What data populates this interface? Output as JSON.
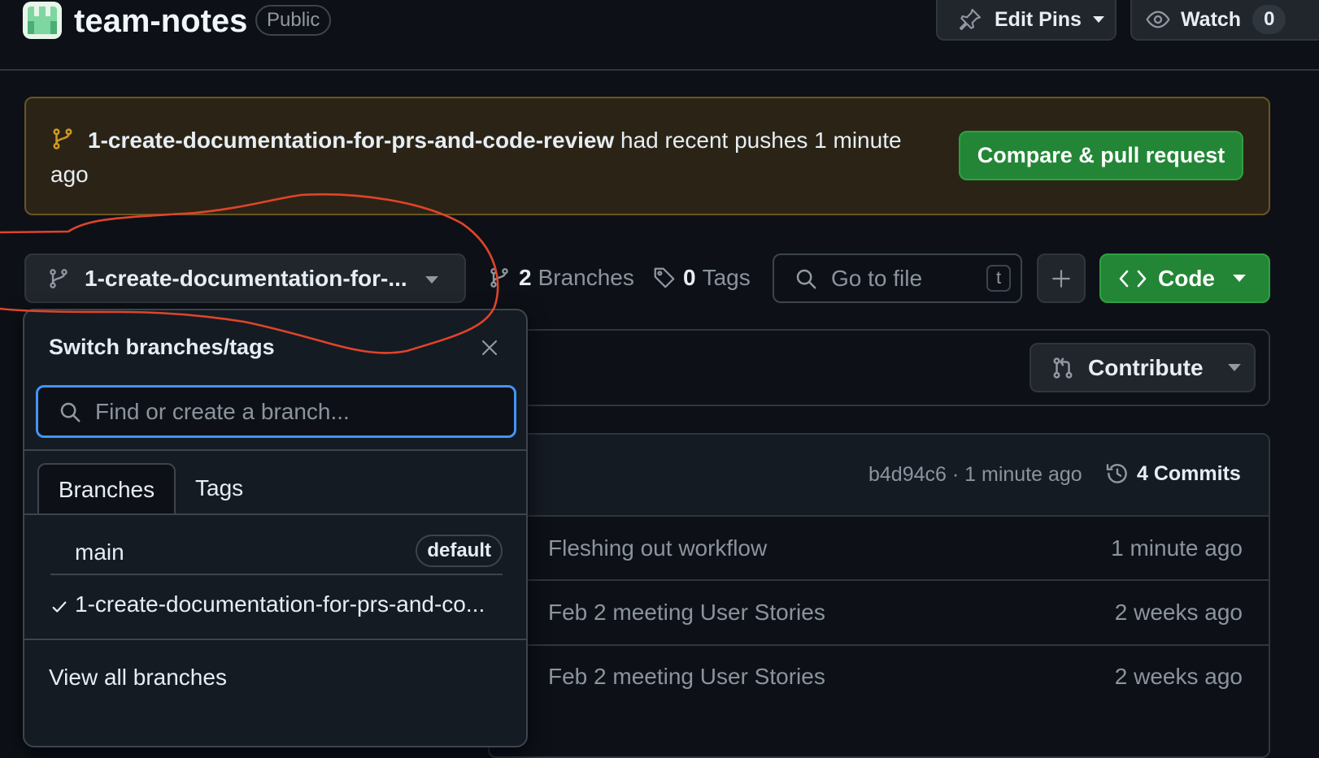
{
  "repo": {
    "name": "team-notes",
    "visibility": "Public"
  },
  "header": {
    "edit_pins_label": "Edit Pins",
    "watch_label": "Watch",
    "watch_count": "0"
  },
  "banner": {
    "branch_name": "1-create-documentation-for-prs-and-code-review",
    "message": "had recent pushes 1 minute ago",
    "compare_button": "Compare & pull request"
  },
  "toolbar": {
    "branch_selector_label": "1-create-documentation-for-...",
    "branches_count": "2",
    "branches_label": "Branches",
    "tags_count": "0",
    "tags_label": "Tags",
    "goto_placeholder": "Go to file",
    "goto_shortcut": "t",
    "code_label": "Code"
  },
  "contribute": {
    "label": "Contribute"
  },
  "commit_info": {
    "sha_time": "b4d94c6 · 1 minute ago",
    "commits_label": "4 Commits"
  },
  "files": [
    {
      "message": "Fleshing out workflow",
      "time": "1 minute ago"
    },
    {
      "message": "Feb 2 meeting User Stories",
      "time": "2 weeks ago"
    },
    {
      "message": "Feb 2 meeting User Stories",
      "time": "2 weeks ago"
    }
  ],
  "dropdown": {
    "title": "Switch branches/tags",
    "search_placeholder": "Find or create a branch...",
    "tabs": [
      "Branches",
      "Tags"
    ],
    "branches": [
      {
        "name": "main",
        "badge": "default",
        "selected": false
      },
      {
        "name": "1-create-documentation-for-prs-and-co...",
        "badge": "",
        "selected": true
      }
    ],
    "view_all": "View all branches"
  },
  "colors": {
    "background": "#0d1117",
    "border": "#30363d",
    "button_bg": "#21262d",
    "green": "#238636",
    "banner_bg": "#2b2416",
    "banner_border": "#6a5424",
    "focus_blue": "#4493f8",
    "annotation_red": "#e0442a"
  }
}
